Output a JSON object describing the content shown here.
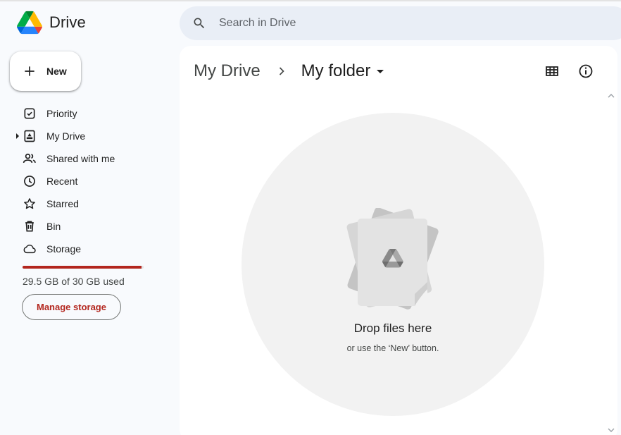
{
  "app": {
    "name": "Drive"
  },
  "search": {
    "placeholder": "Search in Drive"
  },
  "new_button": {
    "label": "New"
  },
  "sidebar": {
    "items": [
      {
        "label": "Priority",
        "icon": "priority-icon"
      },
      {
        "label": "My Drive",
        "icon": "my-drive-icon"
      },
      {
        "label": "Shared with me",
        "icon": "shared-icon"
      },
      {
        "label": "Recent",
        "icon": "clock-icon"
      },
      {
        "label": "Starred",
        "icon": "star-icon"
      },
      {
        "label": "Bin",
        "icon": "bin-icon"
      },
      {
        "label": "Storage",
        "icon": "cloud-icon"
      }
    ],
    "storage": {
      "used_text": "29.5 GB of 30 GB used",
      "used_fraction": 0.983,
      "bar_color": "#b3261e",
      "manage_label": "Manage storage"
    }
  },
  "breadcrumb": {
    "root": "My Drive",
    "current": "My folder"
  },
  "empty_state": {
    "title": "Drop files here",
    "subtitle": "or use the ‘New’ button."
  },
  "colors": {
    "accent_red": "#b3261e",
    "page_bg": "#f8fafd",
    "search_bg": "#e9eef6"
  }
}
